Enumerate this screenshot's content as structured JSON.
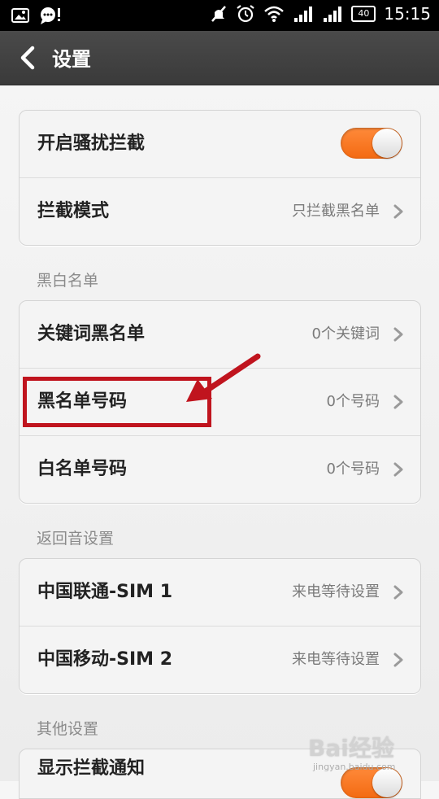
{
  "status_bar": {
    "time": "15:15",
    "battery": "40"
  },
  "header": {
    "title": "设置"
  },
  "interception": {
    "toggle_label": "开启骚扰拦截",
    "toggle_on": true,
    "mode_label": "拦截模式",
    "mode_value": "只拦截黑名单"
  },
  "lists_section": {
    "title": "黑白名单",
    "items": [
      {
        "label": "关键词黑名单",
        "value": "0个关键词"
      },
      {
        "label": "黑名单号码",
        "value": "0个号码"
      },
      {
        "label": "白名单号码",
        "value": "0个号码"
      }
    ]
  },
  "busy_tone_section": {
    "title": "返回音设置",
    "items": [
      {
        "label": "中国联通-SIM 1",
        "value": "来电等待设置"
      },
      {
        "label": "中国移动-SIM 2",
        "value": "来电等待设置"
      }
    ]
  },
  "other_section": {
    "title": "其他设置",
    "items": [
      {
        "label": "显示拦截通知"
      }
    ]
  },
  "watermark": {
    "logo": "Bai经验",
    "sub": "jingyan.baidu.com"
  },
  "colors": {
    "toggle_on": "#f36a12",
    "highlight": "#c0141e",
    "header_bg": "#3f3f3f"
  }
}
